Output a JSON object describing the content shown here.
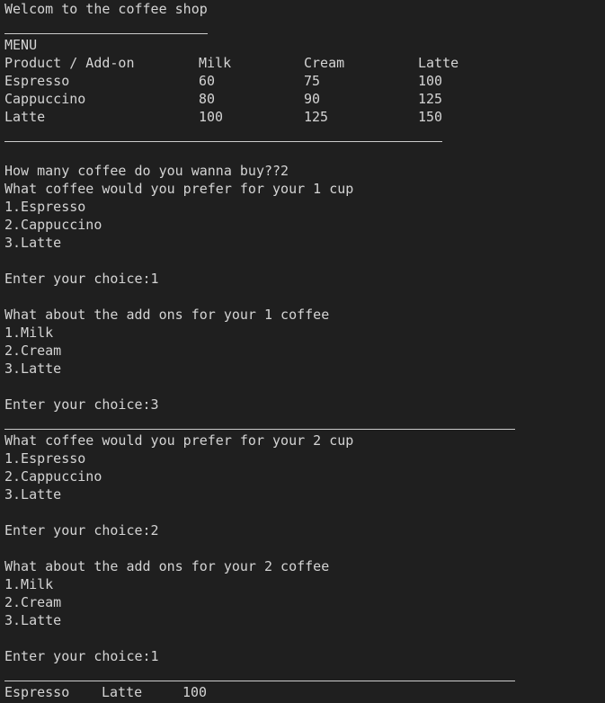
{
  "terminal": {
    "welcome": "Welcom to the coffee shop",
    "menu_title": "MENU",
    "menu_headers": [
      "Product / Add-on",
      "Milk",
      "Cream",
      "Latte"
    ],
    "menu_rows": [
      [
        "Espresso",
        "60",
        "75",
        "100"
      ],
      [
        "Cappuccino",
        "80",
        "90",
        "125"
      ],
      [
        "Latte",
        "100",
        "125",
        "150"
      ]
    ],
    "quantity_prompt": "How many coffee do you wanna buy??2",
    "cup1_prompt": "What coffee would you prefer for your 1 cup",
    "cup1_options": [
      "1.Espresso",
      "2.Cappuccino",
      "3.Latte"
    ],
    "cup1_choice": "Enter your choice:1",
    "addon1_prompt": "What about the add ons for your 1 coffee",
    "addon1_options": [
      "1.Milk",
      "2.Cream",
      "3.Latte"
    ],
    "addon1_choice": "Enter your choice:3",
    "cup2_prompt": "What coffee would you prefer for your 2 cup",
    "cup2_options": [
      "1.Espresso",
      "2.Cappuccino",
      "3.Latte"
    ],
    "cup2_choice": "Enter your choice:2",
    "addon2_prompt": "What about the add ons for your 2 coffee",
    "addon2_options": [
      "1.Milk",
      "2.Cream",
      "3.Latte"
    ],
    "addon2_choice": "Enter your choice:1",
    "summary": [
      "Espresso",
      "Latte",
      "100"
    ]
  }
}
